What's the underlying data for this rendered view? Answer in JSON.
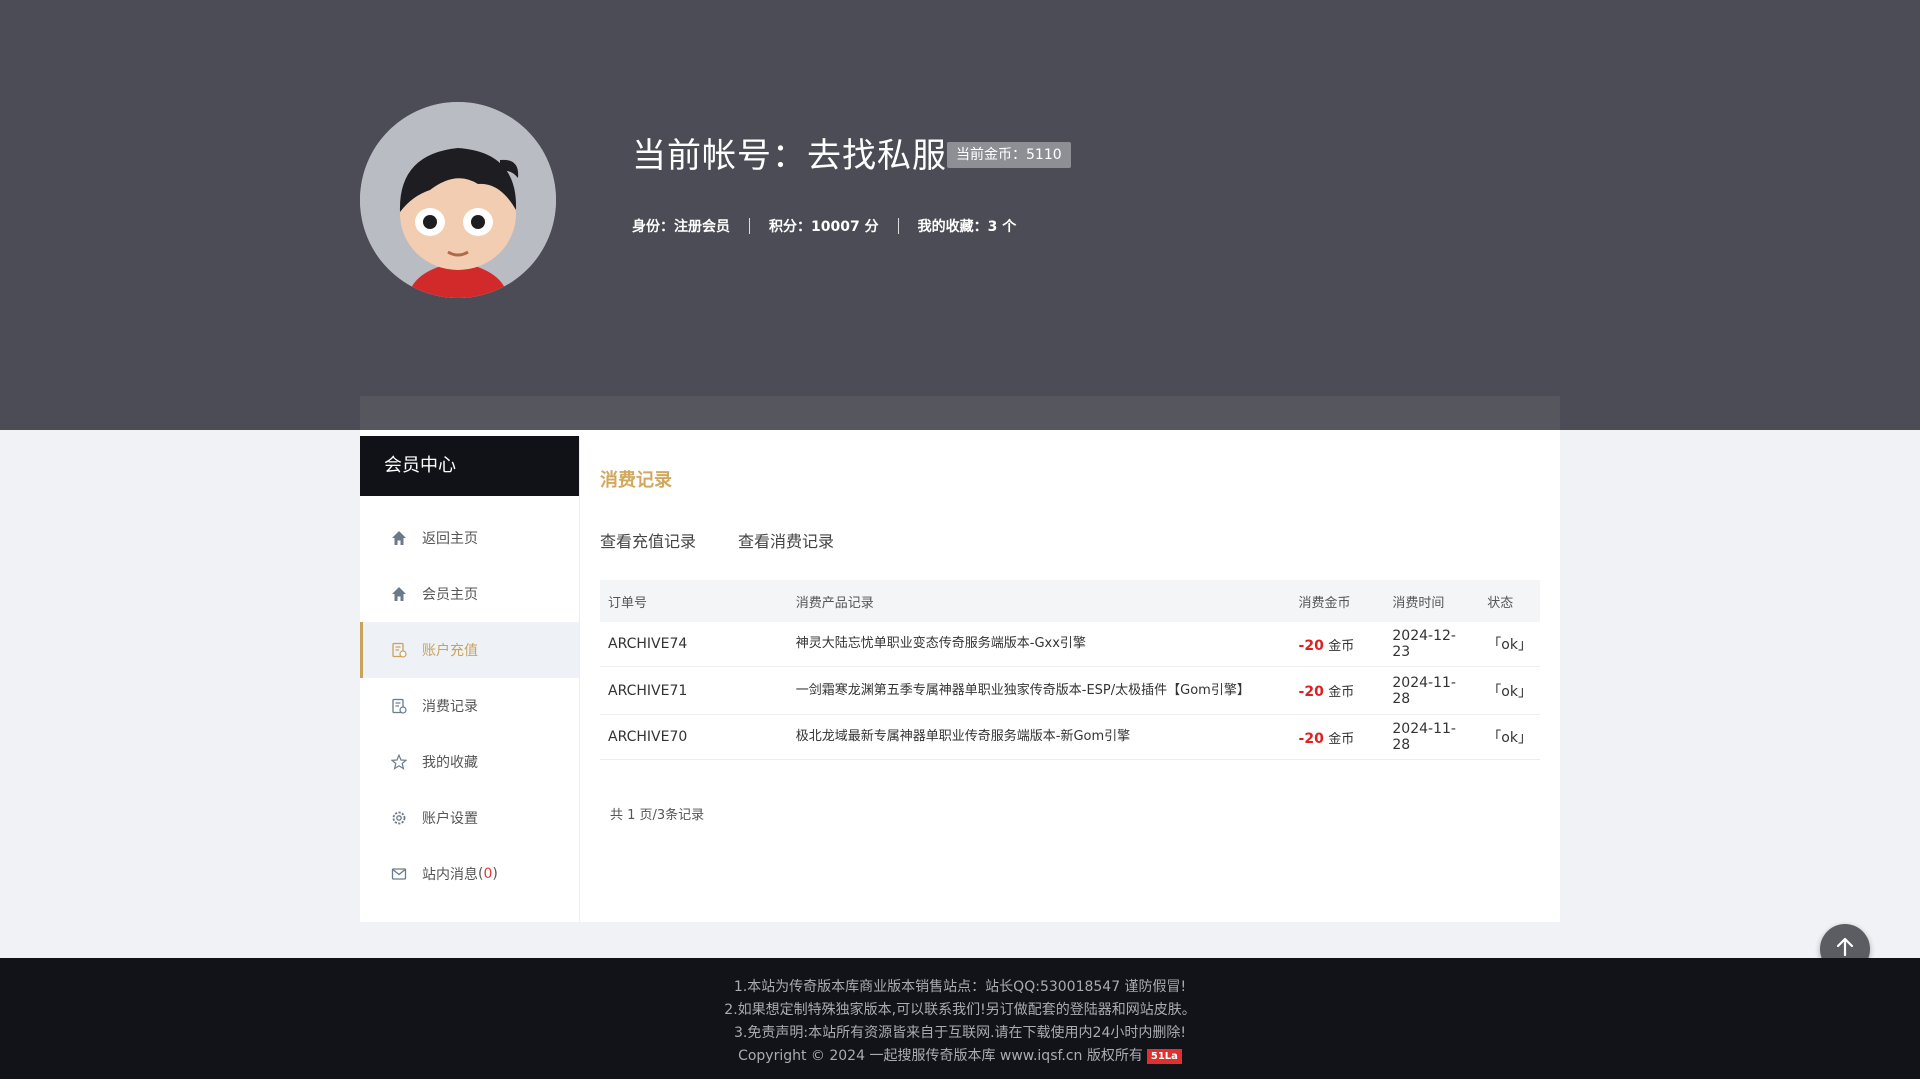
{
  "header": {
    "account_label": "当前帐号：",
    "account_name": "去找私服",
    "coin_badge": "当前金币：5110",
    "identity_label": "身份：",
    "identity_value": "注册会员",
    "points_label": "积分：",
    "points_value": "10007 分",
    "favorites_label": "我的收藏：",
    "favorites_value": "3 个"
  },
  "sidebar": {
    "title": "会员中心",
    "items": [
      {
        "label": "返回主页",
        "icon": "home-icon"
      },
      {
        "label": "会员主页",
        "icon": "home-icon"
      },
      {
        "label": "账户充值",
        "icon": "recharge-icon",
        "active": true
      },
      {
        "label": "消费记录",
        "icon": "record-icon"
      },
      {
        "label": "我的收藏",
        "icon": "star-icon"
      },
      {
        "label": "账户设置",
        "icon": "gear-icon"
      },
      {
        "label": "站内消息",
        "icon": "mail-icon",
        "count": "0"
      }
    ]
  },
  "main": {
    "title": "消费记录",
    "tabs": [
      "查看充值记录",
      "查看消费记录"
    ],
    "table": {
      "headers": [
        "订单号",
        "消费产品记录",
        "消费金币",
        "消费时间",
        "状态"
      ],
      "rows": [
        {
          "order": "ARCHIVE74",
          "product": "神灵大陆忘忧单职业变态传奇服务端版本-Gxx引擎",
          "amount": "-20",
          "unit": "金币",
          "time": "2024-12-23",
          "status": "「ok」"
        },
        {
          "order": "ARCHIVE71",
          "product": "一剑霜寒龙渊第五季专属神器单职业独家传奇版本-ESP/太极插件【Gom引擎】",
          "amount": "-20",
          "unit": "金币",
          "time": "2024-11-28",
          "status": "「ok」"
        },
        {
          "order": "ARCHIVE70",
          "product": "极北龙域最新专属神器单职业传奇服务端版本-新Gom引擎",
          "amount": "-20",
          "unit": "金币",
          "time": "2024-11-28",
          "status": "「ok」"
        }
      ]
    },
    "pager": "共 1 页/3条记录"
  },
  "footer": {
    "line1": "1.本站为传奇版本库商业版本销售站点：站长QQ:530018547 谨防假冒!",
    "line2": "2.如果想定制特殊独家版本,可以联系我们!另订做配套的登陆器和网站皮肤。",
    "line3": "3.免责声明:本站所有资源皆来自于互联网.请在下载使用内24小时内删除!",
    "copyright": "Copyright © 2024 一起搜服传奇版本库 www.iqsf.cn 版权所有",
    "badge": "51La"
  },
  "colors": {
    "header_bg": "#4c4c56",
    "accent": "#c9a35b",
    "negative": "#e02020",
    "status_ok": "#1a9c1a",
    "footer_bg": "#121319"
  }
}
